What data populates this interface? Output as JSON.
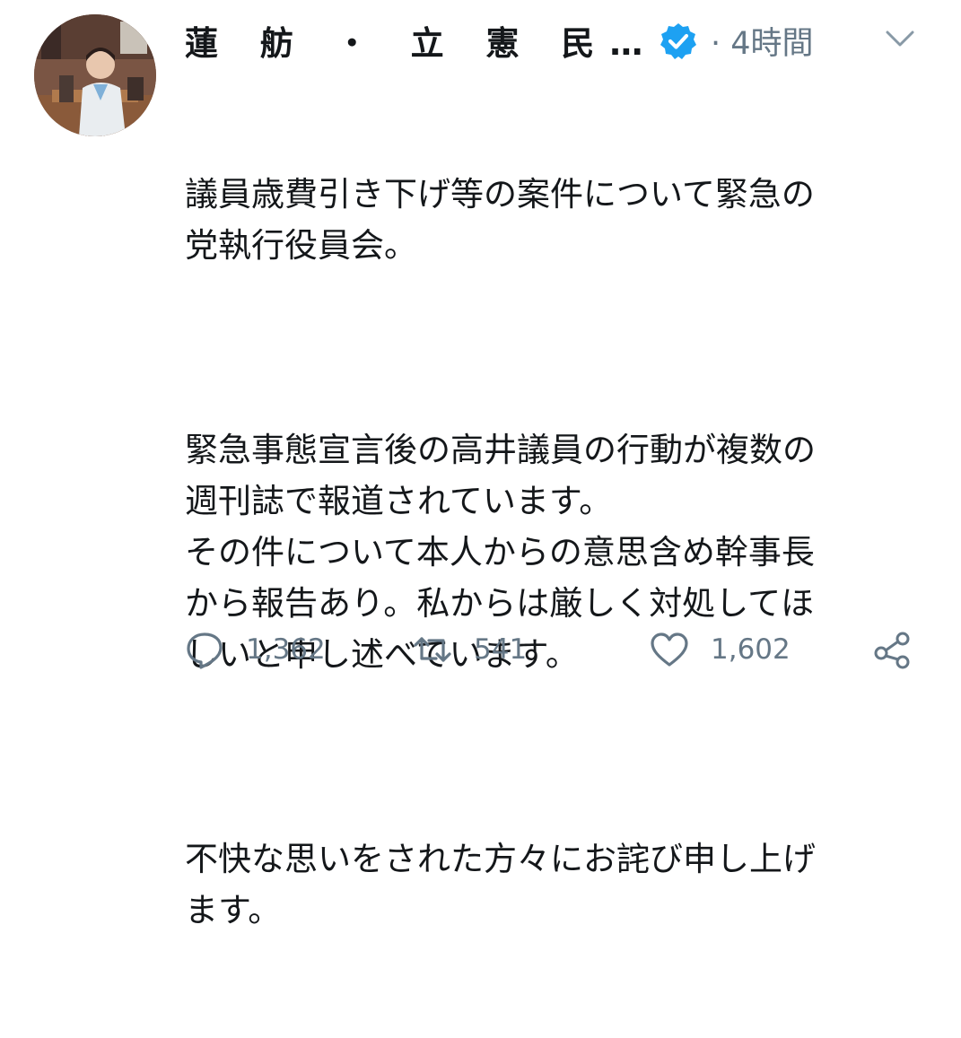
{
  "tweet": {
    "author": {
      "display_name": "蓮 舫 ・ 立 憲 民…",
      "verified": true,
      "avatar_icon": "profile-photo"
    },
    "time": "· 4時間",
    "menu_icon": "chevron-down-icon",
    "paragraphs": [
      "議員歳費引き下げ等の案件について緊急の\n党執行役員会。",
      "緊急事態宣言後の高井議員の行動が複数の\n週刊誌で報道されています。\nその件について本人からの意思含め幹事長\nから報告あり。私からは厳しく対処してほ\nしいと申し述べています。",
      "不快な思いをされた方々にお詫び申し上げ\nます。"
    ],
    "actions": {
      "reply_count": "1,362",
      "retweet_count": "541",
      "like_count": "1,602"
    }
  },
  "colors": {
    "text": "#14171a",
    "secondary": "#657786",
    "verified": "#1da1f2",
    "background": "#ffffff"
  }
}
